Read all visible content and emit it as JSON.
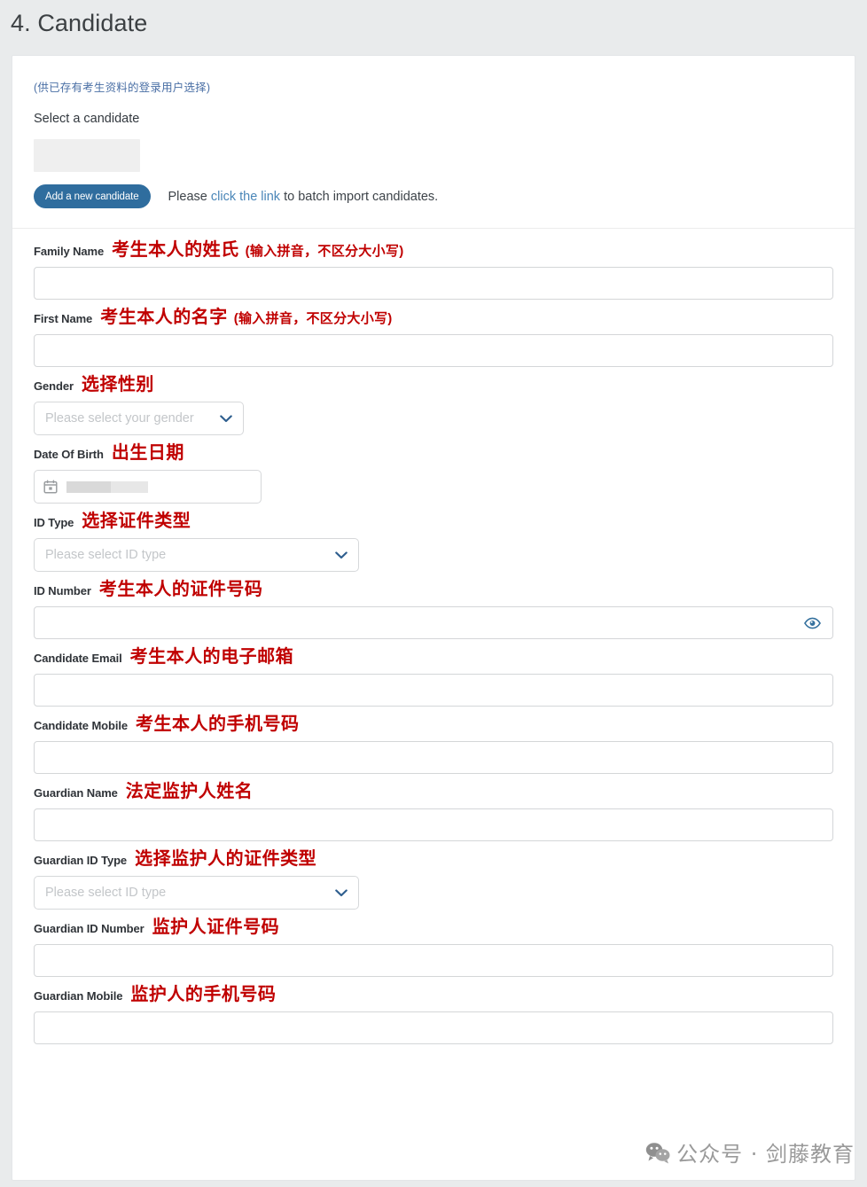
{
  "page": {
    "title": "4. Candidate",
    "background_color": "#e9ebec"
  },
  "colors": {
    "accent_blue": "#2f6d9e",
    "link_blue": "#4a86b8",
    "annotation_red": "#c00000",
    "hint_blue": "#4a6fa5",
    "placeholder_gray": "#c3c6c9"
  },
  "top": {
    "hint_cn": "(供已存有考生资料的登录用户选择)",
    "select_candidate_label": "Select a candidate",
    "candidate_value": "",
    "add_button_label": "Add a new candidate",
    "import_prefix": "Please ",
    "import_link": "click the link",
    "import_suffix": " to batch import candidates."
  },
  "fields": [
    {
      "id": "family-name",
      "label_en": "Family Name",
      "label_cn": "考生本人的姓氏",
      "label_cn_note": "(输入拼音，不区分大小写)",
      "type": "text",
      "value": "",
      "placeholder": ""
    },
    {
      "id": "first-name",
      "label_en": "First Name",
      "label_cn": "考生本人的名字",
      "label_cn_note": "(输入拼音，不区分大小写)",
      "type": "text",
      "value": "",
      "placeholder": ""
    },
    {
      "id": "gender",
      "label_en": "Gender",
      "label_cn": "选择性别",
      "type": "select",
      "placeholder": "Please select your gender",
      "value": ""
    },
    {
      "id": "date-of-birth",
      "label_en": "Date Of Birth",
      "label_cn": "出生日期",
      "type": "date",
      "value": "",
      "redacted": true
    },
    {
      "id": "id-type",
      "label_en": "ID Type",
      "label_cn": "选择证件类型",
      "type": "select",
      "placeholder": "Please select ID type",
      "value": ""
    },
    {
      "id": "id-number",
      "label_en": "ID Number",
      "label_cn": "考生本人的证件号码",
      "type": "password",
      "value": "",
      "placeholder": "",
      "trailing_icon": "eye-icon"
    },
    {
      "id": "candidate-email",
      "label_en": "Candidate Email",
      "label_cn": "考生本人的电子邮箱",
      "type": "text",
      "value": "",
      "placeholder": ""
    },
    {
      "id": "candidate-mobile",
      "label_en": "Candidate Mobile",
      "label_cn": "考生本人的手机号码",
      "type": "text",
      "value": "",
      "placeholder": ""
    },
    {
      "id": "guardian-name",
      "label_en": "Guardian Name",
      "label_cn": "法定监护人姓名",
      "type": "text",
      "value": "",
      "placeholder": ""
    },
    {
      "id": "guardian-id-type",
      "label_en": "Guardian ID Type",
      "label_cn": "选择监护人的证件类型",
      "type": "select",
      "placeholder": "Please select ID type",
      "value": ""
    },
    {
      "id": "guardian-id-number",
      "label_en": "Guardian ID Number",
      "label_cn": "监护人证件号码",
      "type": "text",
      "value": "",
      "placeholder": ""
    },
    {
      "id": "guardian-mobile",
      "label_en": "Guardian Mobile",
      "label_cn": "监护人的手机号码",
      "type": "text",
      "value": "",
      "placeholder": ""
    }
  ],
  "watermark": {
    "icon": "wechat-icon",
    "text": "公众号 · 剑藤教育"
  }
}
